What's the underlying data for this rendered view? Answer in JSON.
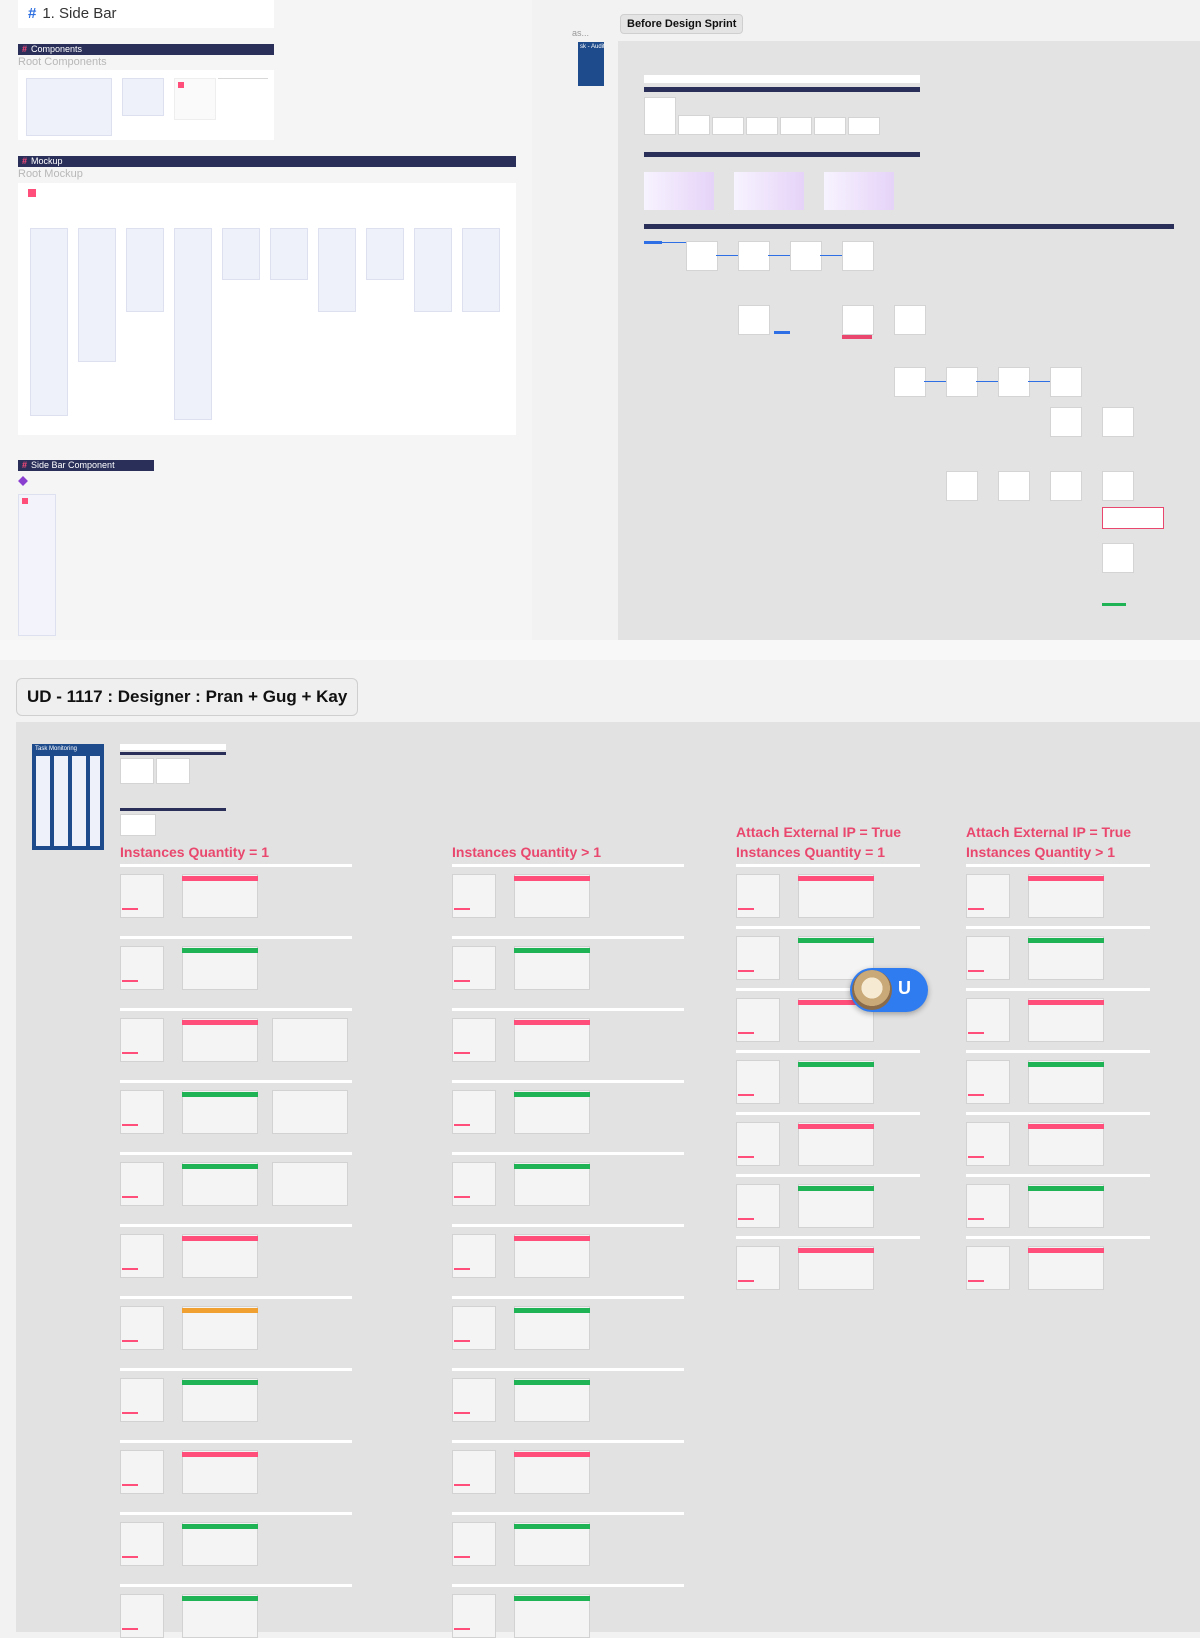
{
  "side_bar_board": {
    "page_heading": "1. Side Bar",
    "sections": {
      "components": {
        "title": "Components",
        "subtitle": "Root Components"
      },
      "mockup": {
        "title": "Mockup",
        "subtitle": "Root Mockup"
      },
      "side_bar_component": {
        "title": "Side Bar Component"
      }
    }
  },
  "sprint_board": {
    "chip_label": "Before Design Sprint",
    "partial_label": "sk - Audit",
    "partial_crumb": "as..."
  },
  "ud_board": {
    "chip_label": "UD - 1117 : Designer : Pran + Gug + Kay",
    "task_monitor_title": "Task Monitoring",
    "columns": [
      {
        "title_lines": [
          "Instances Quantity = 1"
        ]
      },
      {
        "title_lines": [
          "Instances Quantity > 1"
        ]
      },
      {
        "title_lines": [
          "Attach External IP = True",
          "Instances Quantity = 1"
        ]
      },
      {
        "title_lines": [
          "Attach External IP = True",
          "Instances Quantity > 1"
        ]
      }
    ]
  },
  "collaborator": {
    "initial": "U",
    "accent": "#2f7bf0"
  },
  "colors": {
    "navy": "#2a2f5a",
    "pink": "#ff4e7a",
    "heading_pink": "#e9476d",
    "green": "#1fb356",
    "blue": "#2f6fe6"
  }
}
